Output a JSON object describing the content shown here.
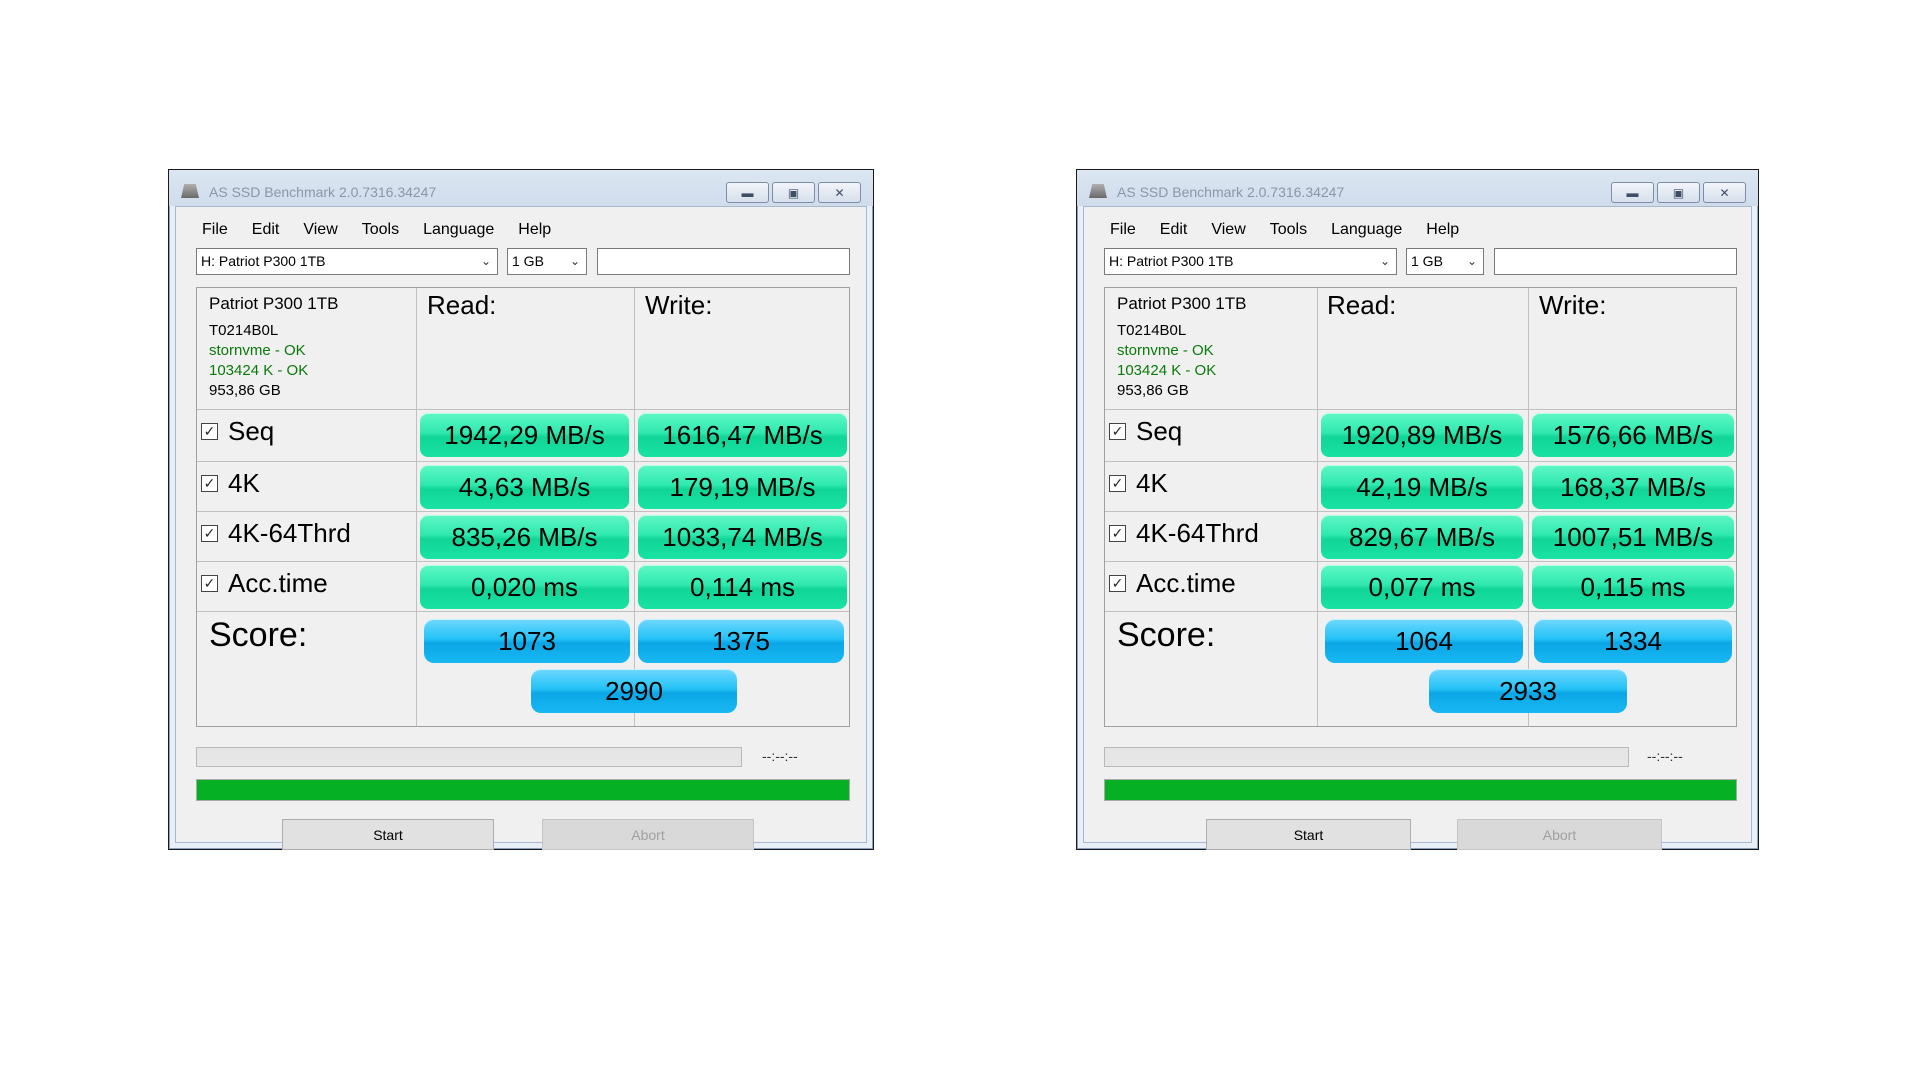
{
  "windows": [
    {
      "title": "AS SSD Benchmark 2.0.7316.34247",
      "menu": [
        "File",
        "Edit",
        "View",
        "Tools",
        "Language",
        "Help"
      ],
      "drive_select": "H: Patriot P300 1TB",
      "size_select": "1 GB",
      "device": {
        "name": "Patriot P300 1TB",
        "firmware": "T0214B0L",
        "driver": "stornvme - OK",
        "alignment": "103424 K - OK",
        "capacity": "953,86 GB"
      },
      "headers": {
        "read": "Read:",
        "write": "Write:"
      },
      "rows": [
        {
          "label": "Seq",
          "checked": true,
          "read": "1942,29 MB/s",
          "write": "1616,47 MB/s"
        },
        {
          "label": "4K",
          "checked": true,
          "read": "43,63 MB/s",
          "write": "179,19 MB/s"
        },
        {
          "label": "4K-64Thrd",
          "checked": true,
          "read": "835,26 MB/s",
          "write": "1033,74 MB/s"
        },
        {
          "label": "Acc.time",
          "checked": true,
          "read": "0,020 ms",
          "write": "0,114 ms"
        }
      ],
      "score": {
        "label": "Score:",
        "read": "1073",
        "write": "1375",
        "total": "2990"
      },
      "time_display": "--:--:--",
      "progress": 1.0,
      "buttons": {
        "start": "Start",
        "abort": "Abort"
      }
    },
    {
      "title": "AS SSD Benchmark 2.0.7316.34247",
      "menu": [
        "File",
        "Edit",
        "View",
        "Tools",
        "Language",
        "Help"
      ],
      "drive_select": "H: Patriot P300 1TB",
      "size_select": "1 GB",
      "device": {
        "name": "Patriot P300 1TB",
        "firmware": "T0214B0L",
        "driver": "stornvme - OK",
        "alignment": "103424 K - OK",
        "capacity": "953,86 GB"
      },
      "headers": {
        "read": "Read:",
        "write": "Write:"
      },
      "rows": [
        {
          "label": "Seq",
          "checked": true,
          "read": "1920,89 MB/s",
          "write": "1576,66 MB/s"
        },
        {
          "label": "4K",
          "checked": true,
          "read": "42,19 MB/s",
          "write": "168,37 MB/s"
        },
        {
          "label": "4K-64Thrd",
          "checked": true,
          "read": "829,67 MB/s",
          "write": "1007,51 MB/s"
        },
        {
          "label": "Acc.time",
          "checked": true,
          "read": "0,077 ms",
          "write": "0,115 ms"
        }
      ],
      "score": {
        "label": "Score:",
        "read": "1064",
        "write": "1334",
        "total": "2933"
      },
      "time_display": "--:--:--",
      "progress": 1.0,
      "buttons": {
        "start": "Start",
        "abort": "Abort"
      }
    }
  ],
  "colors": {
    "result_green": "#19e3a4",
    "score_blue": "#19b8f2",
    "progress_green": "#06b025",
    "driver_ok_green": "#0a7a0a"
  },
  "icons": [
    "app-disk-icon",
    "minimize-icon",
    "maximize-icon",
    "close-icon",
    "chevron-down-icon",
    "checkbox-checked-icon"
  ]
}
